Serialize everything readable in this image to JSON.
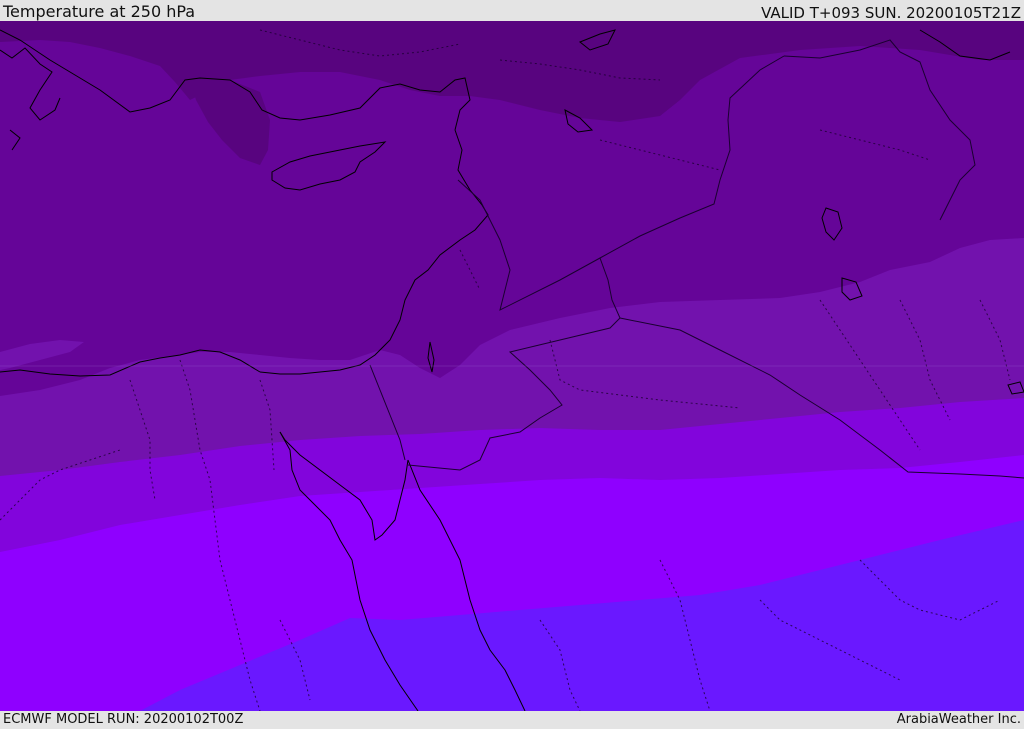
{
  "header": {
    "title": "Temperature at 250 hPa",
    "valid": "VALID T+093 SUN. 20200105T21Z"
  },
  "footer": {
    "model_run": "ECMWF MODEL RUN: 20200102T00Z",
    "credit": "ArabiaWeather Inc."
  },
  "map": {
    "colors": {
      "band_darkest": "#58047f",
      "band_dark": "#650598",
      "band_mid": "#7212ad",
      "band_violet": "#8205dc",
      "band_bright": "#8f00ff",
      "band_blue": "#6a18ff",
      "coastline": "#000000",
      "border": "#1a0030"
    }
  }
}
